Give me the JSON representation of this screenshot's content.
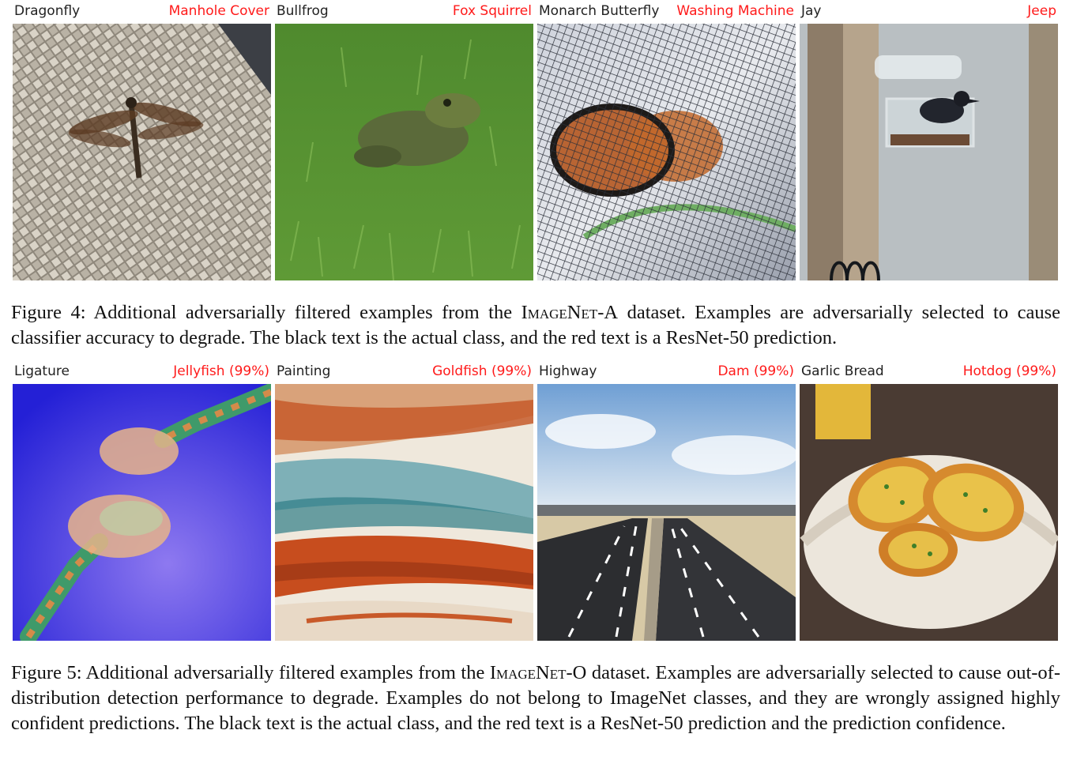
{
  "figure4": {
    "panels": [
      {
        "actual": "Dragonfly",
        "predicted": "Manhole Cover"
      },
      {
        "actual": "Bullfrog",
        "predicted": "Fox Squirrel"
      },
      {
        "actual": "Monarch Butterfly",
        "predicted": "Washing Machine"
      },
      {
        "actual": "Jay",
        "predicted": "Jeep"
      }
    ],
    "caption_prefix": "Figure 4: Additional adversarially filtered examples from the ",
    "caption_dataset": "ImageNet-A",
    "caption_suffix": " dataset. Examples are adversarially selected to cause classifier accuracy to degrade. The black text is the actual class, and the red text is a ResNet-50 prediction."
  },
  "figure5": {
    "panels": [
      {
        "actual": "Ligature",
        "predicted": "Jellyfish (99%)"
      },
      {
        "actual": "Painting",
        "predicted": "Goldfish (99%)"
      },
      {
        "actual": "Highway",
        "predicted": "Dam (99%)"
      },
      {
        "actual": "Garlic Bread",
        "predicted": "Hotdog (99%)"
      }
    ],
    "caption_prefix": "Figure 5: Additional adversarially filtered examples from the ",
    "caption_dataset": "ImageNet-O",
    "caption_suffix": " dataset. Examples are adversarially selected to cause out-of-distribution detection performance to degrade. Examples do not belong to ImageNet classes, and they are wrongly assigned highly confident predictions. The black text is the actual class, and the red text is a ResNet-50 prediction and the prediction confidence."
  },
  "colors": {
    "actual_text": "#222222",
    "predicted_text": "#ff1a1a"
  }
}
